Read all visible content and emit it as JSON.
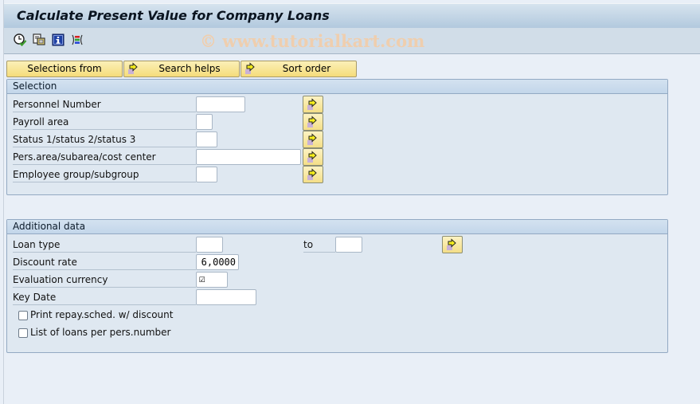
{
  "window": {
    "title": "Calculate Present Value for Company Loans",
    "watermark": "© www.tutorialkart.com"
  },
  "toolbar": {
    "icons": [
      {
        "name": "execute-clock-icon",
        "tooltip": "Execute in background"
      },
      {
        "name": "get-variant-icon",
        "tooltip": "Get variant"
      },
      {
        "name": "info-icon",
        "tooltip": "Program documentation"
      },
      {
        "name": "selection-options-icon",
        "tooltip": "Selection options"
      }
    ]
  },
  "top_buttons": {
    "selections_from": "Selections from",
    "search_helps": "Search helps",
    "sort_order": "Sort order"
  },
  "selection": {
    "title": "Selection",
    "fields": [
      {
        "label": "Personnel Number",
        "value": ""
      },
      {
        "label": "Payroll area",
        "value": ""
      },
      {
        "label": "Status 1/status 2/status 3",
        "value": ""
      },
      {
        "label": "Pers.area/subarea/cost center",
        "value": ""
      },
      {
        "label": "Employee group/subgroup",
        "value": ""
      }
    ]
  },
  "additional": {
    "title": "Additional data",
    "loan_type": {
      "label": "Loan type",
      "from": "",
      "to_label": "to",
      "to": ""
    },
    "discount_rate": {
      "label": "Discount rate",
      "value": "6,0000"
    },
    "evaluation_currency": {
      "label": "Evaluation currency",
      "checked": true,
      "glyph": "☑"
    },
    "key_date": {
      "label": "Key Date",
      "value": ""
    },
    "print_repay": {
      "label": "Print repay.sched. w/ discount",
      "checked": false
    },
    "list_loans": {
      "label": "List of loans per pers.number",
      "checked": false
    }
  },
  "colors": {
    "title_bar": "#b2c9de",
    "button_yellow": "#f5dc7a",
    "group_border": "#93a9c3",
    "background": "#e9eff7"
  }
}
